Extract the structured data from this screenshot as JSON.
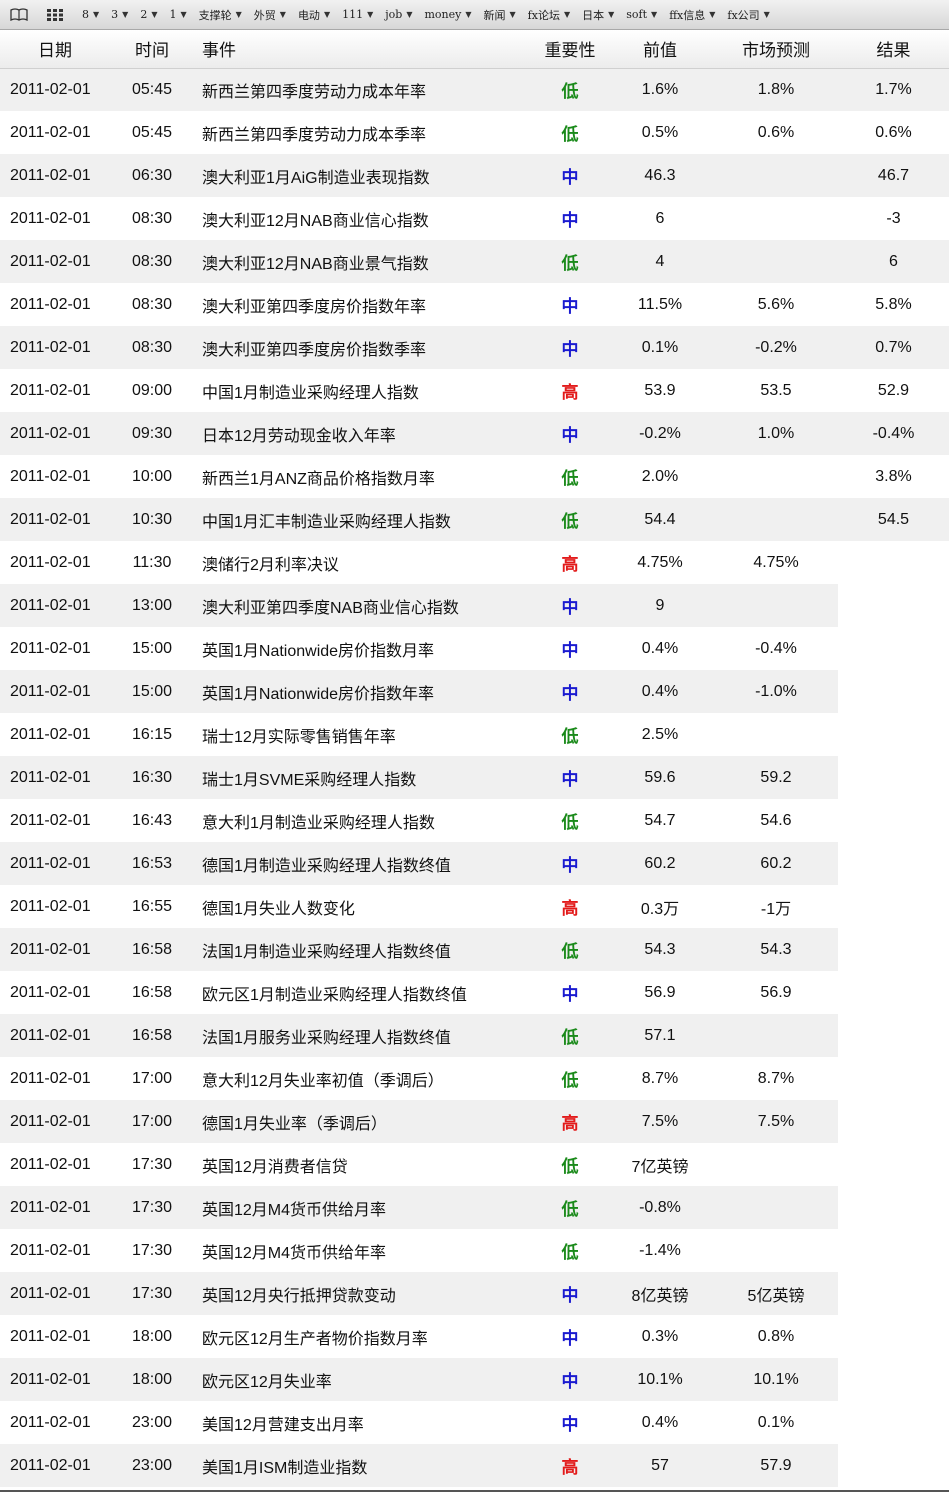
{
  "bookmarks": [
    {
      "label": "8"
    },
    {
      "label": "3"
    },
    {
      "label": "2"
    },
    {
      "label": "1"
    },
    {
      "label": "支撑轮"
    },
    {
      "label": "外贸"
    },
    {
      "label": "电动"
    },
    {
      "label": "111"
    },
    {
      "label": "job"
    },
    {
      "label": "money"
    },
    {
      "label": "新闻"
    },
    {
      "label": "fx论坛"
    },
    {
      "label": "日本"
    },
    {
      "label": "soft"
    },
    {
      "label": "ffx信息"
    },
    {
      "label": "fx公司"
    }
  ],
  "headers": {
    "date": "日期",
    "time": "时间",
    "event": "事件",
    "importance": "重要性",
    "previous": "前值",
    "forecast": "市场预测",
    "result": "结果"
  },
  "colors": {
    "low": "#1a8a1a",
    "mid": "#1a1ad0",
    "high": "#e21a1a"
  },
  "rows": [
    {
      "date": "2011-02-01",
      "time": "05:45",
      "event": "新西兰第四季度劳动力成本年率",
      "importance": "低",
      "level": "low",
      "previous": "1.6%",
      "forecast": "1.8%",
      "result": "1.7%"
    },
    {
      "date": "2011-02-01",
      "time": "05:45",
      "event": "新西兰第四季度劳动力成本季率",
      "importance": "低",
      "level": "low",
      "previous": "0.5%",
      "forecast": "0.6%",
      "result": "0.6%"
    },
    {
      "date": "2011-02-01",
      "time": "06:30",
      "event": "澳大利亚1月AiG制造业表现指数",
      "importance": "中",
      "level": "mid",
      "previous": "46.3",
      "forecast": "",
      "result": "46.7"
    },
    {
      "date": "2011-02-01",
      "time": "08:30",
      "event": "澳大利亚12月NAB商业信心指数",
      "importance": "中",
      "level": "mid",
      "previous": "6",
      "forecast": "",
      "result": "-3"
    },
    {
      "date": "2011-02-01",
      "time": "08:30",
      "event": "澳大利亚12月NAB商业景气指数",
      "importance": "低",
      "level": "low",
      "previous": "4",
      "forecast": "",
      "result": "6"
    },
    {
      "date": "2011-02-01",
      "time": "08:30",
      "event": "澳大利亚第四季度房价指数年率",
      "importance": "中",
      "level": "mid",
      "previous": "11.5%",
      "forecast": "5.6%",
      "result": "5.8%"
    },
    {
      "date": "2011-02-01",
      "time": "08:30",
      "event": "澳大利亚第四季度房价指数季率",
      "importance": "中",
      "level": "mid",
      "previous": "0.1%",
      "forecast": "-0.2%",
      "result": "0.7%"
    },
    {
      "date": "2011-02-01",
      "time": "09:00",
      "event": "中国1月制造业采购经理人指数",
      "importance": "高",
      "level": "high",
      "previous": "53.9",
      "forecast": "53.5",
      "result": "52.9"
    },
    {
      "date": "2011-02-01",
      "time": "09:30",
      "event": "日本12月劳动现金收入年率",
      "importance": "中",
      "level": "mid",
      "previous": "-0.2%",
      "forecast": "1.0%",
      "result": "-0.4%"
    },
    {
      "date": "2011-02-01",
      "time": "10:00",
      "event": "新西兰1月ANZ商品价格指数月率",
      "importance": "低",
      "level": "low",
      "previous": "2.0%",
      "forecast": "",
      "result": "3.8%"
    },
    {
      "date": "2011-02-01",
      "time": "10:30",
      "event": "中国1月汇丰制造业采购经理人指数",
      "importance": "低",
      "level": "low",
      "previous": "54.4",
      "forecast": "",
      "result": "54.5"
    },
    {
      "date": "2011-02-01",
      "time": "11:30",
      "event": "澳储行2月利率决议",
      "importance": "高",
      "level": "high",
      "previous": "4.75%",
      "forecast": "4.75%",
      "result": ""
    },
    {
      "date": "2011-02-01",
      "time": "13:00",
      "event": "澳大利亚第四季度NAB商业信心指数",
      "importance": "中",
      "level": "mid",
      "previous": "9",
      "forecast": "",
      "result": ""
    },
    {
      "date": "2011-02-01",
      "time": "15:00",
      "event": "英国1月Nationwide房价指数月率",
      "importance": "中",
      "level": "mid",
      "previous": "0.4%",
      "forecast": "-0.4%",
      "result": ""
    },
    {
      "date": "2011-02-01",
      "time": "15:00",
      "event": "英国1月Nationwide房价指数年率",
      "importance": "中",
      "level": "mid",
      "previous": "0.4%",
      "forecast": "-1.0%",
      "result": ""
    },
    {
      "date": "2011-02-01",
      "time": "16:15",
      "event": "瑞士12月实际零售销售年率",
      "importance": "低",
      "level": "low",
      "previous": "2.5%",
      "forecast": "",
      "result": ""
    },
    {
      "date": "2011-02-01",
      "time": "16:30",
      "event": "瑞士1月SVME采购经理人指数",
      "importance": "中",
      "level": "mid",
      "previous": "59.6",
      "forecast": "59.2",
      "result": ""
    },
    {
      "date": "2011-02-01",
      "time": "16:43",
      "event": "意大利1月制造业采购经理人指数",
      "importance": "低",
      "level": "low",
      "previous": "54.7",
      "forecast": "54.6",
      "result": ""
    },
    {
      "date": "2011-02-01",
      "time": "16:53",
      "event": "德国1月制造业采购经理人指数终值",
      "importance": "中",
      "level": "mid",
      "previous": "60.2",
      "forecast": "60.2",
      "result": ""
    },
    {
      "date": "2011-02-01",
      "time": "16:55",
      "event": "德国1月失业人数变化",
      "importance": "高",
      "level": "high",
      "previous": "0.3万",
      "forecast": "-1万",
      "result": ""
    },
    {
      "date": "2011-02-01",
      "time": "16:58",
      "event": "法国1月制造业采购经理人指数终值",
      "importance": "低",
      "level": "low",
      "previous": "54.3",
      "forecast": "54.3",
      "result": ""
    },
    {
      "date": "2011-02-01",
      "time": "16:58",
      "event": "欧元区1月制造业采购经理人指数终值",
      "importance": "中",
      "level": "mid",
      "previous": "56.9",
      "forecast": "56.9",
      "result": ""
    },
    {
      "date": "2011-02-01",
      "time": "16:58",
      "event": "法国1月服务业采购经理人指数终值",
      "importance": "低",
      "level": "low",
      "previous": "57.1",
      "forecast": "",
      "result": ""
    },
    {
      "date": "2011-02-01",
      "time": "17:00",
      "event": "意大利12月失业率初值（季调后）",
      "importance": "低",
      "level": "low",
      "previous": "8.7%",
      "forecast": "8.7%",
      "result": ""
    },
    {
      "date": "2011-02-01",
      "time": "17:00",
      "event": "德国1月失业率（季调后）",
      "importance": "高",
      "level": "high",
      "previous": "7.5%",
      "forecast": "7.5%",
      "result": ""
    },
    {
      "date": "2011-02-01",
      "time": "17:30",
      "event": "英国12月消费者信贷",
      "importance": "低",
      "level": "low",
      "previous": "7亿英镑",
      "forecast": "",
      "result": ""
    },
    {
      "date": "2011-02-01",
      "time": "17:30",
      "event": "英国12月M4货币供给月率",
      "importance": "低",
      "level": "low",
      "previous": "-0.8%",
      "forecast": "",
      "result": ""
    },
    {
      "date": "2011-02-01",
      "time": "17:30",
      "event": "英国12月M4货币供给年率",
      "importance": "低",
      "level": "low",
      "previous": "-1.4%",
      "forecast": "",
      "result": ""
    },
    {
      "date": "2011-02-01",
      "time": "17:30",
      "event": "英国12月央行抵押贷款变动",
      "importance": "中",
      "level": "mid",
      "previous": "8亿英镑",
      "forecast": "5亿英镑",
      "result": ""
    },
    {
      "date": "2011-02-01",
      "time": "18:00",
      "event": "欧元区12月生产者物价指数月率",
      "importance": "中",
      "level": "mid",
      "previous": "0.3%",
      "forecast": "0.8%",
      "result": ""
    },
    {
      "date": "2011-02-01",
      "time": "18:00",
      "event": "欧元区12月失业率",
      "importance": "中",
      "level": "mid",
      "previous": "10.1%",
      "forecast": "10.1%",
      "result": ""
    },
    {
      "date": "2011-02-01",
      "time": "23:00",
      "event": "美国12月营建支出月率",
      "importance": "中",
      "level": "mid",
      "previous": "0.4%",
      "forecast": "0.1%",
      "result": ""
    },
    {
      "date": "2011-02-01",
      "time": "23:00",
      "event": "美国1月ISM制造业指数",
      "importance": "高",
      "level": "high",
      "previous": "57",
      "forecast": "57.9",
      "result": ""
    }
  ]
}
